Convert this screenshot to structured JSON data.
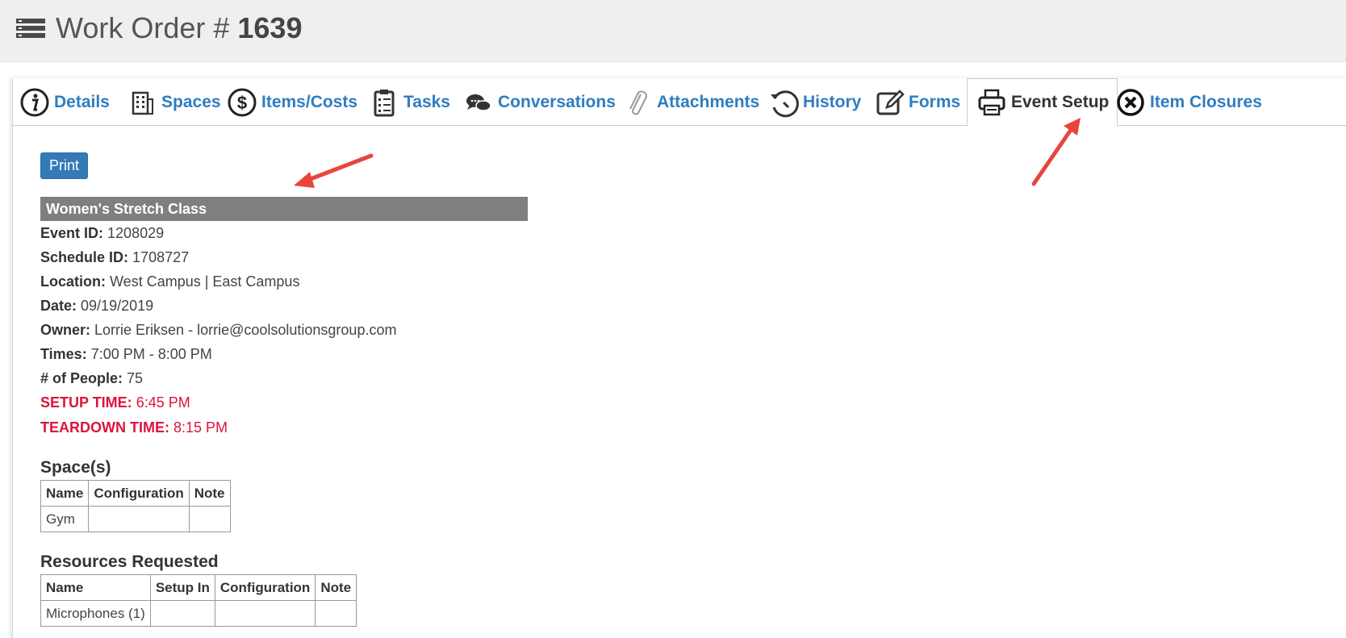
{
  "header": {
    "title_prefix": "Work Order # ",
    "order_number": "1639",
    "menu_icon": "list-icon"
  },
  "tabs": [
    {
      "label": "Details",
      "icon": "info-icon",
      "active": false
    },
    {
      "label": "Spaces",
      "icon": "building-icon",
      "active": false
    },
    {
      "label": "Items/Costs",
      "icon": "dollar-icon",
      "active": false
    },
    {
      "label": "Tasks",
      "icon": "clipboard-icon",
      "active": false
    },
    {
      "label": "Conversations",
      "icon": "chat-icon",
      "active": false
    },
    {
      "label": "Attachments",
      "icon": "paperclip-icon",
      "active": false
    },
    {
      "label": "History",
      "icon": "history-icon",
      "active": false
    },
    {
      "label": "Forms",
      "icon": "edit-icon",
      "active": false
    },
    {
      "label": "Event Setup",
      "icon": "printer-icon",
      "active": true
    },
    {
      "label": "Item Closures",
      "icon": "close-circle-icon",
      "active": false
    }
  ],
  "print_button": "Print",
  "event": {
    "name": "Women's Stretch Class",
    "fields": [
      {
        "label": "Event ID:",
        "value": "1208029"
      },
      {
        "label": "Schedule ID:",
        "value": "1708727"
      },
      {
        "label": "Location:",
        "value": "West Campus | East Campus"
      },
      {
        "label": "Date:",
        "value": "09/19/2019"
      },
      {
        "label": "Owner:",
        "value": "Lorrie Eriksen - lorrie@coolsolutionsgroup.com"
      },
      {
        "label": "Times:",
        "value": "7:00 PM - 8:00 PM"
      },
      {
        "label": "# of People:",
        "value": "75"
      },
      {
        "label": "SETUP TIME:",
        "value": "6:45 PM"
      },
      {
        "label": "TEARDOWN TIME:",
        "value": "8:15 PM"
      }
    ],
    "highlight_color": "#dc143c"
  },
  "spaces": {
    "title": "Space(s)",
    "columns": [
      "Name",
      "Configuration",
      "Note"
    ],
    "rows": [
      [
        "Gym",
        "",
        ""
      ]
    ]
  },
  "resources": {
    "title": "Resources Requested",
    "columns": [
      "Name",
      "Setup In",
      "Configuration",
      "Note"
    ],
    "rows": [
      [
        "Microphones (1)",
        "",
        "",
        ""
      ]
    ]
  },
  "colors": {
    "link": "#2e7dc2",
    "button": "#337ab7",
    "header_bar": "#7f7f7f",
    "annotation_arrow": "#e8453c"
  }
}
